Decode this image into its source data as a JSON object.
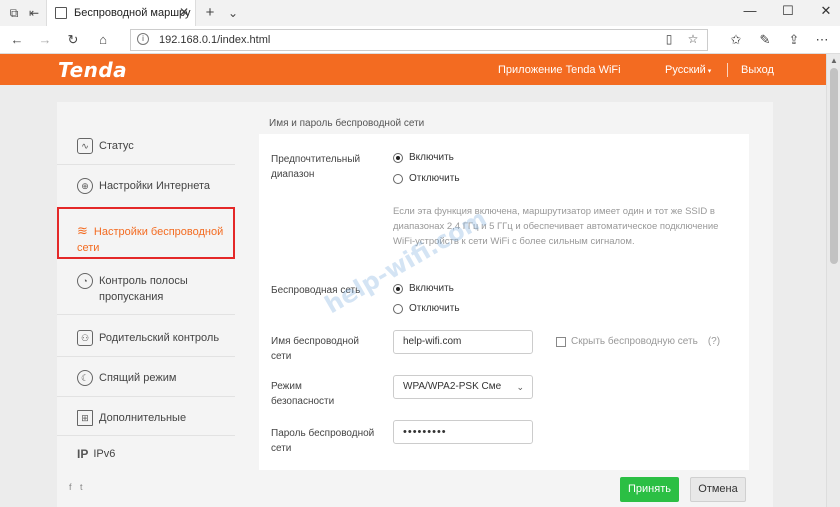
{
  "browser": {
    "tab_title": "Беспроводной маршру",
    "url": "192.168.0.1/index.html",
    "tab_close_glyph": "✕",
    "new_tab_glyph": "+",
    "tab_menu_glyph": "⌄"
  },
  "header": {
    "logo": "Tenda",
    "app_link": "Приложение Tenda WiFi",
    "language": "Русский",
    "logout": "Выход"
  },
  "sidebar": {
    "items": [
      {
        "label": "Статус"
      },
      {
        "label": "Настройки Интернета"
      },
      {
        "label": "Настройки беспроводной сети"
      },
      {
        "label": "Контроль полосы пропускания"
      },
      {
        "label": "Родительский контроль"
      },
      {
        "label": "Спящий режим"
      },
      {
        "label": "Дополнительные"
      },
      {
        "label": "IPv6"
      }
    ]
  },
  "content": {
    "section_title": "Имя и пароль беспроводной сети",
    "band_label": "Предпочтительный диапазон",
    "band_on": "Включить",
    "band_off": "Отключить",
    "band_desc": "Если эта функция включена, маршрутизатор имеет один и тот же SSID в диапазонах 2,4 ГГц и 5 ГГц и обеспечивает автоматическое подключение WiFi-устройств к сети WiFi с более сильным сигналом.",
    "wireless_label": "Беспроводная сеть",
    "wireless_on": "Включить",
    "wireless_off": "Отключить",
    "ssid_label": "Имя беспроводной сети",
    "ssid_value": "help-wifi.com",
    "hide_ssid": "Скрыть беспроводную сеть",
    "hide_help": "(?)",
    "security_label": "Режим безопасности",
    "security_value": "WPA/WPA2-PSK Сме",
    "password_label": "Пароль беспроводной сети",
    "password_value": "•••••••••",
    "watermark": "help-wifi.com"
  },
  "footer": {
    "apply": "Принять",
    "cancel": "Отмена"
  },
  "colors": {
    "brand": "#f36b21",
    "apply": "#2bbf44",
    "highlight": "#e42828"
  }
}
